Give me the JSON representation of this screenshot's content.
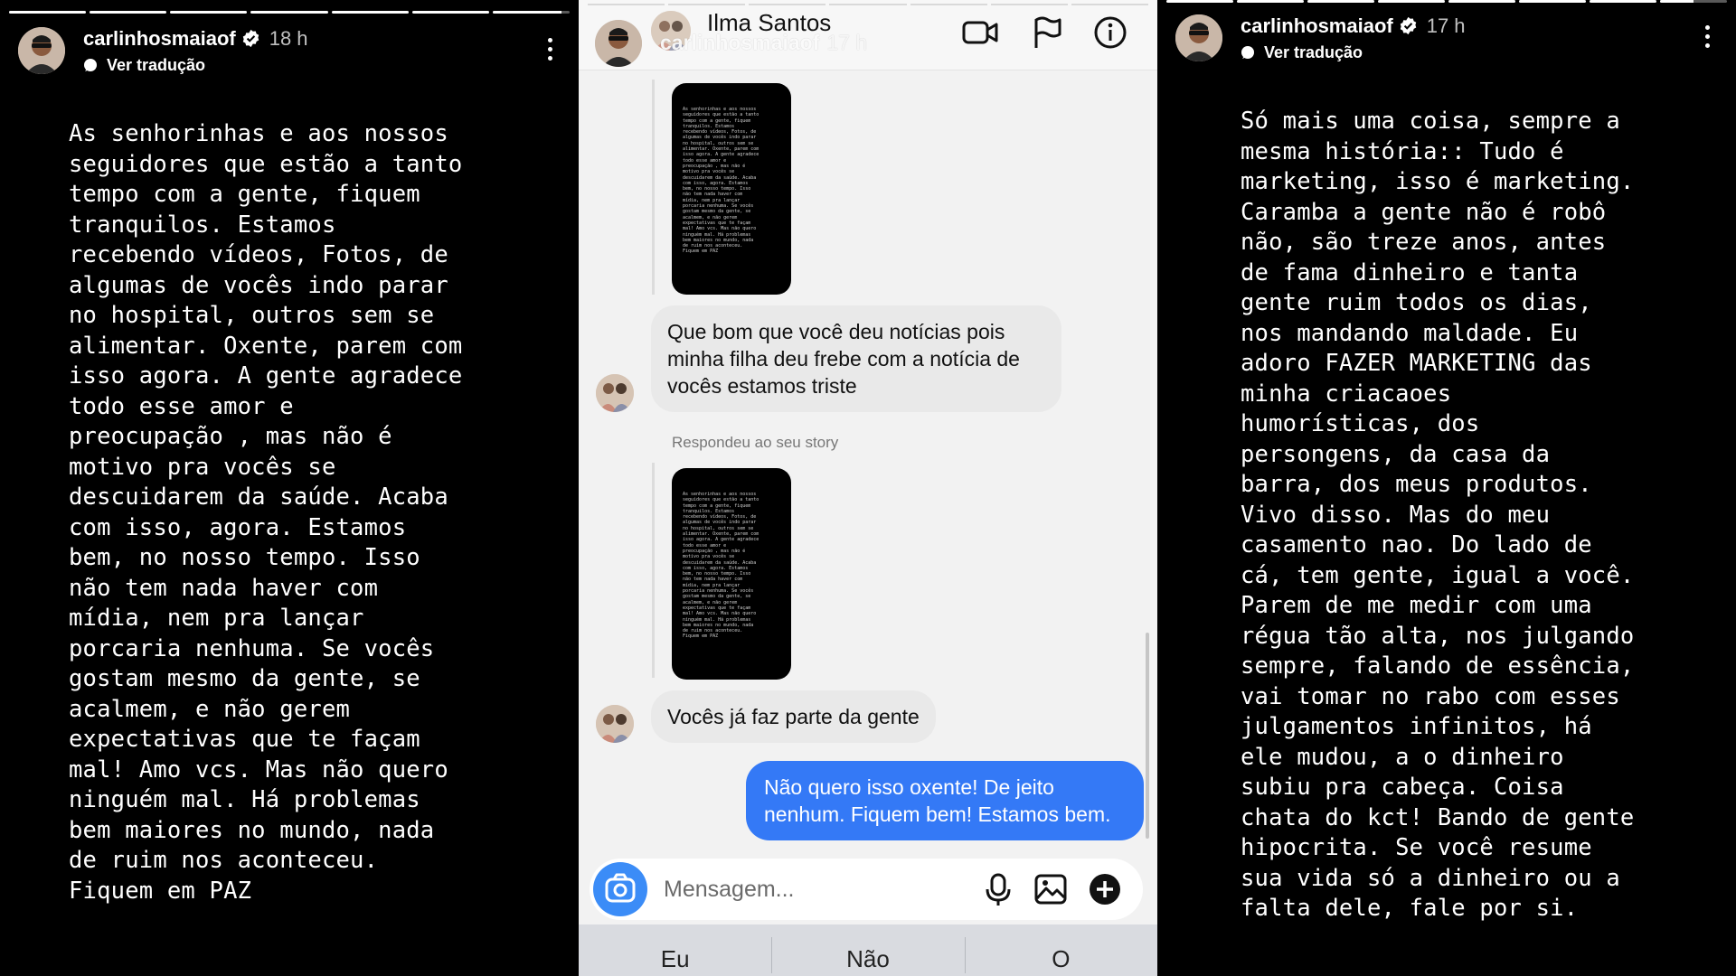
{
  "left_story": {
    "username": "carlinhosmaiaof",
    "time": "18 h",
    "translate": "Ver tradução",
    "text": "As senhorinhas e aos nossos\nseguidores que estão a tanto\ntempo com a gente, fiquem\ntranquilos. Estamos\nrecebendo vídeos, Fotos, de\nalgumas de vocês indo parar\nno hospital, outros sem se\nalimentar. Oxente, parem com\nisso agora. A gente agradece\ntodo esse amor e\npreocupação , mas não é\nmotivo pra vocês se\ndescuidarem da saúde. Acaba\ncom isso, agora. Estamos\nbem, no nosso tempo. Isso\nnão tem nada haver com\nmídia, nem pra lançar\nporcaria nenhuma. Se vocês\ngostam mesmo da gente, se\nacalmem, e não gerem\nexpectativas que te façam\nmal! Amo vcs. Mas não quero\nninguém mal. Há problemas\nbem maiores no mundo, nada\nde ruim nos aconteceu.\nFiquem em PAZ"
  },
  "dm": {
    "contact_name": "Ilma Santos",
    "overlay_username": "carlinhosmaiaof",
    "overlay_time": "17 h",
    "icons": [
      "video-camera-icon",
      "flag-icon",
      "info-icon"
    ],
    "messages": {
      "incoming_1": "Que bom que você deu notícias pois minha filha deu frebe com a notícia de vocês estamos triste",
      "reply_note": "Respondeu ao seu story",
      "incoming_2": "Vocês já faz parte da gente",
      "outgoing_1": "Não quero isso oxente! De jeito nenhum. Fiquem bem! Estamos bem."
    },
    "compose_placeholder": "Mensagem...",
    "suggestions": [
      "Eu",
      "Não",
      "O"
    ]
  },
  "right_story": {
    "username": "carlinhosmaiaof",
    "time": "17 h",
    "translate": "Ver tradução",
    "text": "Só mais uma coisa, sempre a\nmesma história:: Tudo é\nmarketing, isso é marketing.\nCaramba a gente não é robô\nnão, são treze anos, antes\nde fama dinheiro e tanta\ngente ruim todos os dias,\nnos mandando maldade. Eu\nadoro FAZER MARKETING das\nminha criacaoes\nhumorísticas, dos\npersongens, da casa da\nbarra, dos meus produtos.\nVivo disso. Mas do meu\ncasamento nao. Do lado de\ncá, tem gente, igual a você.\nParem de me medir com uma\nrégua tão alta, nos julgando\nsempre, falando de essência,\nvai tomar no rabo com esses\njulgamentos infinitos, há\nele mudou, a o dinheiro\nsubiu pra cabeça. Coisa\nchata do kct! Bando de gente\nhipocrita. Se você resume\nsua vida só a dinheiro ou a\nfalta dele, fale por si."
  },
  "colors": {
    "story_bg": "#000000",
    "dm_bg": "#f2f2f2",
    "incoming_bubble": "#e9e9e9",
    "outgoing_bubble": "#3479f6",
    "verified": "#ffffff",
    "camera_button": "#3b8cf7"
  },
  "progress": {
    "left": [
      1,
      1,
      1,
      1,
      1,
      1,
      0.9
    ],
    "right": [
      1,
      1,
      1,
      1,
      1,
      1,
      1,
      0.5
    ]
  }
}
